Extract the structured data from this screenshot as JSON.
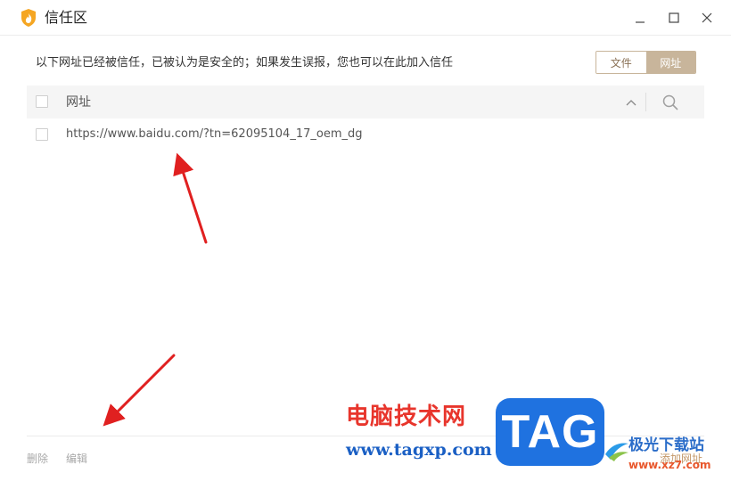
{
  "window": {
    "title": "信任区",
    "logo_icon": "shield-flame-icon",
    "controls": [
      "minimize-icon",
      "maximize-icon",
      "close-icon"
    ]
  },
  "header": {
    "description": "以下网址已经被信任，已被认为是安全的；如果发生误报，您也可以在此加入信任",
    "tabs": [
      {
        "label": "文件",
        "active": false
      },
      {
        "label": "网址",
        "active": true
      }
    ]
  },
  "table": {
    "column_label": "网址",
    "sort_icon": "chevron-up-icon",
    "search_icon": "search-icon",
    "rows": [
      {
        "url": "https://www.baidu.com/?tn=62095104_17_oem_dg",
        "checked": false
      }
    ]
  },
  "footer": {
    "delete_label": "删除",
    "edit_label": "编辑",
    "add_label": "添加网址"
  },
  "watermark": {
    "site_name": "电脑技术网",
    "site_url": "www.tagxp.com",
    "badge": "TAG",
    "brand_name": "极光下载站",
    "brand_url": "www.xz7.com"
  },
  "colors": {
    "accent": "#c8b59b",
    "accent_text": "#8a7155",
    "link_add": "#c4996a",
    "annotation_arrow": "#e02020"
  }
}
